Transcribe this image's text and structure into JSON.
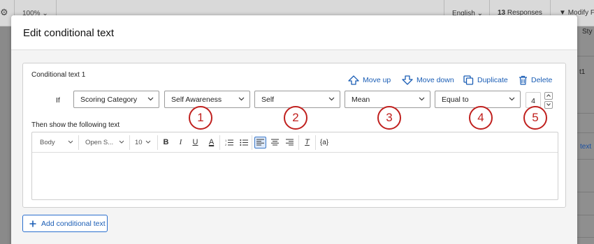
{
  "background": {
    "zoom": "100%",
    "language": "English",
    "responses_count": "13",
    "responses_label": "Responses",
    "modify": "Modify Fi",
    "side_style": "Sty",
    "side_num": "t1",
    "side_text": "text"
  },
  "modal": {
    "title": "Edit conditional text",
    "card": {
      "title": "Conditional text 1",
      "actions": {
        "move_up": "Move up",
        "move_down": "Move down",
        "duplicate": "Duplicate",
        "delete": "Delete"
      },
      "if_label": "If",
      "selects": [
        "Scoring Category",
        "Self Awareness",
        "Self",
        "Mean",
        "Equal to"
      ],
      "value": "4",
      "badges": [
        "1",
        "2",
        "3",
        "4",
        "5"
      ],
      "then_label": "Then show the following text",
      "toolbar": {
        "style": "Body",
        "font": "Open S...",
        "size": "10",
        "bold": "B",
        "italic": "I",
        "underline": "U",
        "font_color": "A",
        "clear_format": "T",
        "piped_text": "{a}"
      }
    },
    "add_button": "Add conditional text"
  },
  "colors": {
    "accent": "#1a5db5",
    "badge": "#c0201e"
  }
}
